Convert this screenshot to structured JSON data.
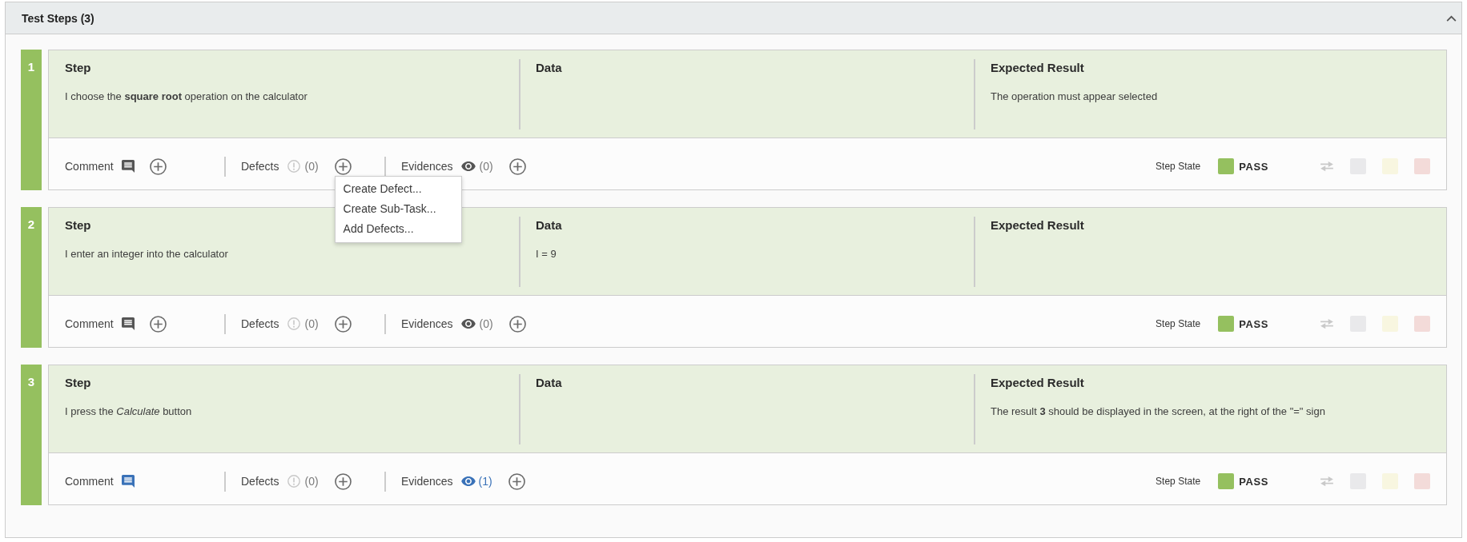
{
  "panel": {
    "title": "Test Steps (3)",
    "expanded": true
  },
  "steps": [
    {
      "number": "1",
      "fields": [
        {
          "heading": "Step",
          "text": "I choose the **square root** operation on the calculator"
        },
        {
          "heading": "Data"
        },
        {
          "heading": "Expected Result",
          "text": "The operation must appear selected"
        }
      ],
      "comment": {
        "label": "Comment",
        "present": false
      },
      "defects": {
        "label": "Defects",
        "count": "(0)",
        "menu": [
          "Create Defect...",
          "Create Sub-Task...",
          "Add Defects..."
        ]
      },
      "evidences": {
        "label": "Evidences",
        "count": "(0)",
        "present": false
      },
      "state": {
        "label": "Step State",
        "status": "PASS",
        "color": "#95c05f"
      },
      "state_buttons": [
        {
          "color": "#e9e9eb"
        },
        {
          "color": "#f8f6e0"
        },
        {
          "color": "#f3dbd9"
        }
      ]
    },
    {
      "number": "2",
      "fields": [
        {
          "heading": "Step",
          "text": "I enter an integer into the calculator"
        },
        {
          "heading": "Data",
          "text": "I = 9"
        },
        {
          "heading": "Expected Result"
        }
      ],
      "comment": {
        "label": "Comment",
        "present": false
      },
      "defects": {
        "label": "Defects",
        "count": "(0)"
      },
      "evidences": {
        "label": "Evidences",
        "count": "(0)",
        "present": false
      },
      "state": {
        "label": "Step State",
        "status": "PASS",
        "color": "#95c05f"
      },
      "state_buttons": [
        {
          "color": "#e9e9eb"
        },
        {
          "color": "#f8f6e0"
        },
        {
          "color": "#f3dbd9"
        }
      ]
    },
    {
      "number": "3",
      "fields": [
        {
          "heading": "Step",
          "text": "I press the *Calculate* button"
        },
        {
          "heading": "Data"
        },
        {
          "heading": "Expected Result",
          "text": "The result **3** should be displayed in the screen, at the right of the \"=\" sign"
        }
      ],
      "comment": {
        "label": "Comment",
        "present": true
      },
      "defects": {
        "label": "Defects",
        "count": "(0)"
      },
      "evidences": {
        "label": "Evidences",
        "count": "(1)",
        "present": true
      },
      "state": {
        "label": "Step State",
        "status": "PASS",
        "color": "#95c05f"
      },
      "state_buttons": [
        {
          "color": "#e9e9eb"
        },
        {
          "color": "#f8f6e0"
        },
        {
          "color": "#f3dbd9"
        }
      ]
    }
  ]
}
